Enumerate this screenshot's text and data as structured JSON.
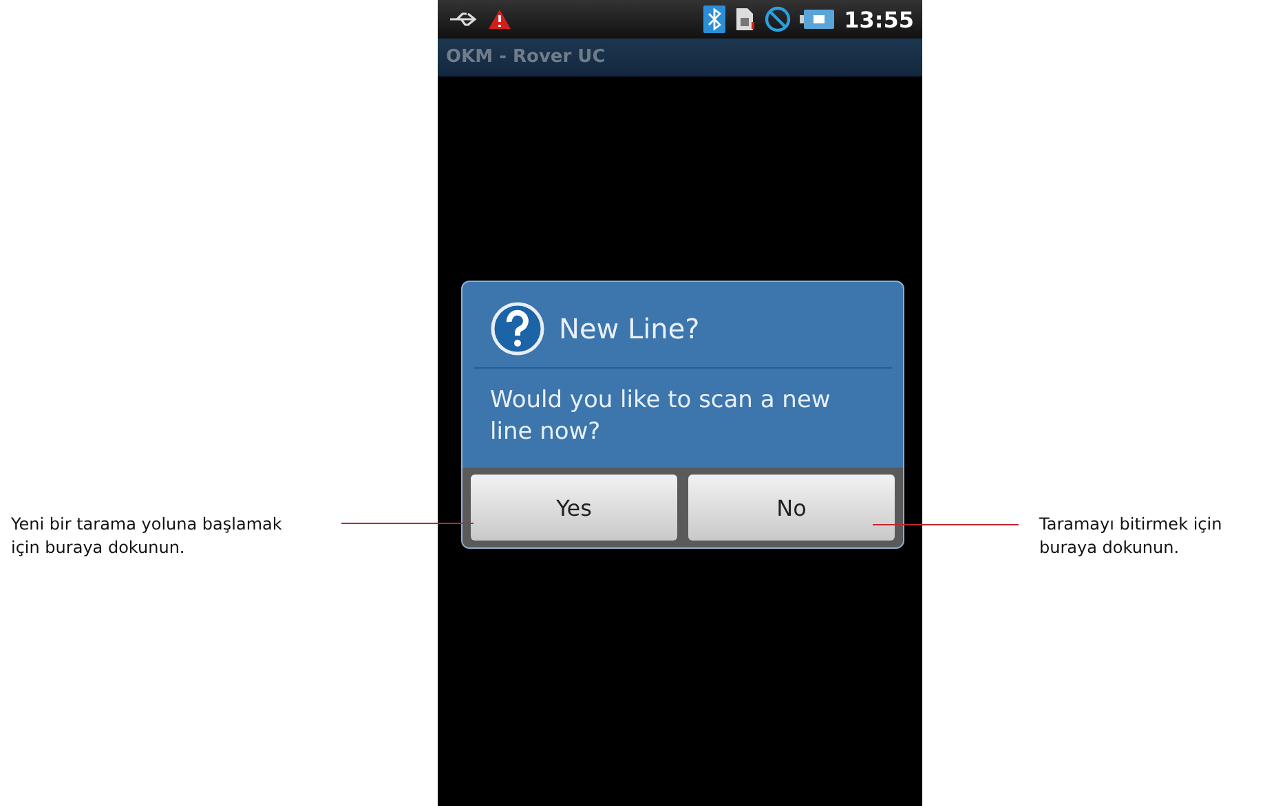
{
  "status_bar": {
    "time": "13:55"
  },
  "app_title": "OKM - Rover UC",
  "dialog": {
    "title": "New Line?",
    "message": "Would you like to scan a new line now?",
    "buttons": [
      "Yes",
      "No"
    ]
  },
  "left_callout": "Yeni bir tarama yoluna başlamak\niçin buraya dokunun.",
  "right_callout": "Taramayı bitirmek için\nburaya dokunun."
}
